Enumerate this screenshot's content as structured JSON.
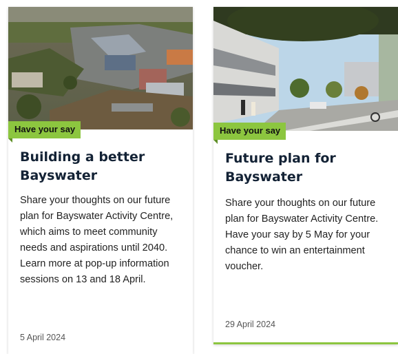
{
  "cards": [
    {
      "tag": "Have your say",
      "title": "Building a better Bayswater",
      "description": "Share your thoughts on our future plan for Bayswater Activity Centre, which aims to meet community needs and aspirations until 2040. Learn more at pop-up information sessions on 13 and 18 April.",
      "date": "5 April 2024",
      "image": "aerial-town-photo"
    },
    {
      "tag": "Have your say",
      "title": "Future plan for Bayswater",
      "description": "Share your thoughts on our future plan for Bayswater Activity Centre. Have your say by 5 May for your chance to win an entertainment voucher.",
      "date": "29 April 2024",
      "image": "street-render-photo"
    }
  ],
  "colors": {
    "tag": "#8cc63f",
    "title": "#132235",
    "accent_border": "#8cc63f"
  }
}
